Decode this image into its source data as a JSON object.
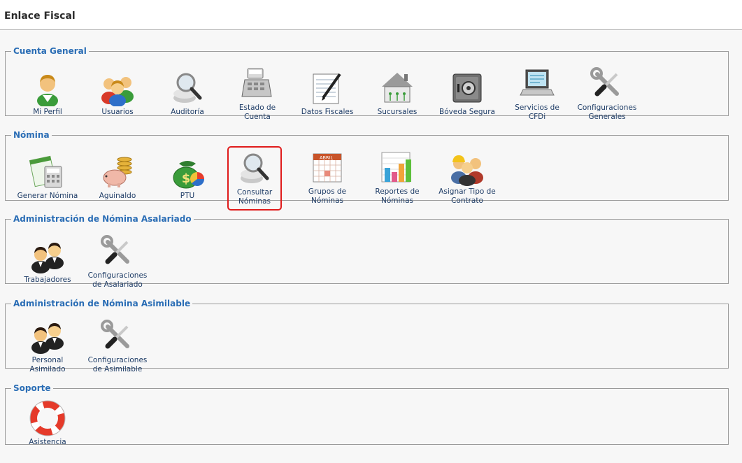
{
  "header": {
    "title": "Enlace Fiscal"
  },
  "sections": [
    {
      "legend": "Cuenta General",
      "items": [
        {
          "label": "Mi Perfil",
          "icon": "user-icon"
        },
        {
          "label": "Usuarios",
          "icon": "users-icon"
        },
        {
          "label": "Auditoría",
          "icon": "magnifier-icon"
        },
        {
          "label": "Estado de Cuenta",
          "icon": "cash-register-icon"
        },
        {
          "label": "Datos Fiscales",
          "icon": "document-pen-icon"
        },
        {
          "label": "Sucursales",
          "icon": "branches-icon"
        },
        {
          "label": "Bóveda Segura",
          "icon": "safe-icon"
        },
        {
          "label": "Servicios de CFDi",
          "icon": "laptop-icon"
        },
        {
          "label": "Configuraciones Generales",
          "icon": "tools-icon"
        }
      ]
    },
    {
      "legend": "Nómina",
      "items": [
        {
          "label": "Generar Nómina",
          "icon": "spreadsheet-calculator-icon"
        },
        {
          "label": "Aguinaldo",
          "icon": "piggy-bank-icon"
        },
        {
          "label": "PTU",
          "icon": "money-bag-icon"
        },
        {
          "label": "Consultar Nóminas",
          "icon": "magnifier-icon",
          "selected": true
        },
        {
          "label": "Grupos de Nóminas",
          "icon": "calendar-icon",
          "calendar_text": "ABRIL"
        },
        {
          "label": "Reportes de Nóminas",
          "icon": "bar-chart-icon"
        },
        {
          "label": "Asignar Tipo de Contrato",
          "icon": "workers-icon"
        }
      ]
    },
    {
      "legend": "Administración de Nómina Asalariado",
      "items": [
        {
          "label": "Trabajadores",
          "icon": "people-icon"
        },
        {
          "label": "Configuraciones de Asalariado",
          "icon": "tools-icon"
        }
      ]
    },
    {
      "legend": "Administración de Nómina Asimilable",
      "items": [
        {
          "label": "Personal Asimilado",
          "icon": "people-icon"
        },
        {
          "label": "Configuraciones de Asimilable",
          "icon": "tools-icon"
        }
      ]
    },
    {
      "legend": "Soporte",
      "items": [
        {
          "label": "Asistencia",
          "icon": "lifebuoy-icon"
        }
      ]
    }
  ],
  "colors": {
    "legend": "#2a6db5",
    "label": "#1e3c66",
    "selected_border": "#e01b1b",
    "border": "#9a9a9a"
  }
}
